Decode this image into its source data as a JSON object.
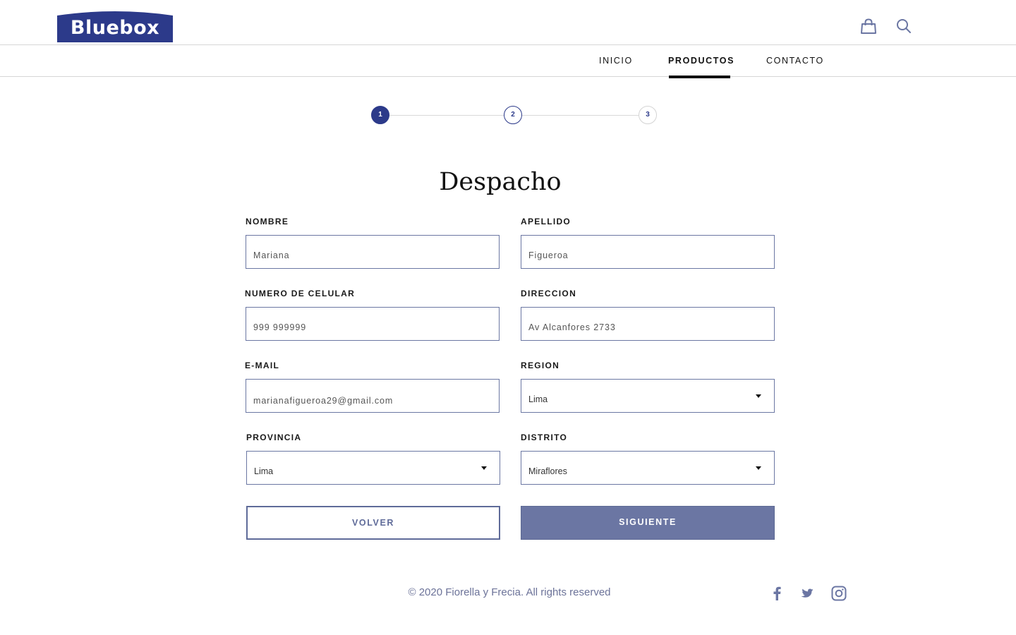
{
  "brand": {
    "name": "Bluebox",
    "color": "#2c3a8a"
  },
  "header": {
    "icons": [
      "shopping-bag-icon",
      "search-icon"
    ]
  },
  "nav": {
    "items": [
      {
        "label": "INICIO",
        "active": false
      },
      {
        "label": "PRODUCTOS",
        "active": true
      },
      {
        "label": "CONTACTO",
        "active": false
      }
    ]
  },
  "stepper": {
    "current": 1,
    "steps": [
      "1",
      "2",
      "3"
    ]
  },
  "form": {
    "title": "Despacho",
    "fields": {
      "nombre": {
        "label": "NOMBRE",
        "value": "Mariana"
      },
      "apellido": {
        "label": "APELLIDO",
        "value": "Figueroa"
      },
      "celular": {
        "label": "NUMERO DE CELULAR",
        "value": "999 999999"
      },
      "direccion": {
        "label": "DIRECCION",
        "value": "Av Alcanfores 2733"
      },
      "email": {
        "label": "E-MAIL",
        "value": "marianafigueroa29@gmail.com"
      },
      "region": {
        "label": "REGION",
        "value": "Lima"
      },
      "provincia": {
        "label": "PROVINCIA",
        "value": "Lima"
      },
      "distrito": {
        "label": "DISTRITO",
        "value": "Miraflores"
      }
    },
    "buttons": {
      "back": "VOLVER",
      "next": "SIGUIENTE"
    }
  },
  "footer": {
    "copyright": "© 2020 Fiorella y Frecia. All rights reserved",
    "social": [
      "facebook-icon",
      "twitter-icon",
      "instagram-icon"
    ]
  },
  "colors": {
    "accent": "#2c3a8a",
    "button_primary": "#6b76a3",
    "border": "#6b77a3",
    "footer_text": "#6c7399"
  }
}
